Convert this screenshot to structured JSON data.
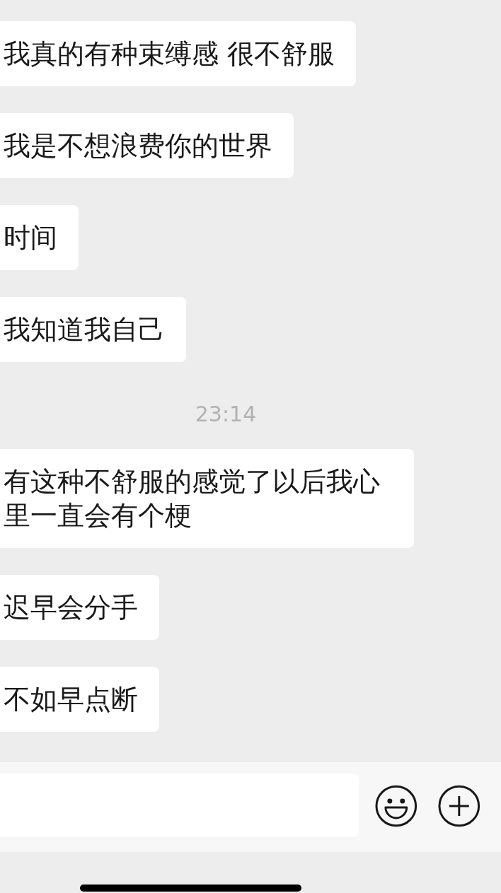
{
  "messages": [
    {
      "kind": "bubble",
      "text": "我真的有种束缚感 很不舒服"
    },
    {
      "kind": "bubble",
      "text": "我是不想浪费你的世界"
    },
    {
      "kind": "bubble",
      "text": "时间"
    },
    {
      "kind": "bubble",
      "text": "我知道我自己"
    },
    {
      "kind": "time",
      "text": "23:14"
    },
    {
      "kind": "bubble",
      "text": "有这种不舒服的感觉了以后我心里一直会有个梗"
    },
    {
      "kind": "bubble",
      "text": "迟早会分手"
    },
    {
      "kind": "bubble",
      "text": "不如早点断"
    }
  ]
}
